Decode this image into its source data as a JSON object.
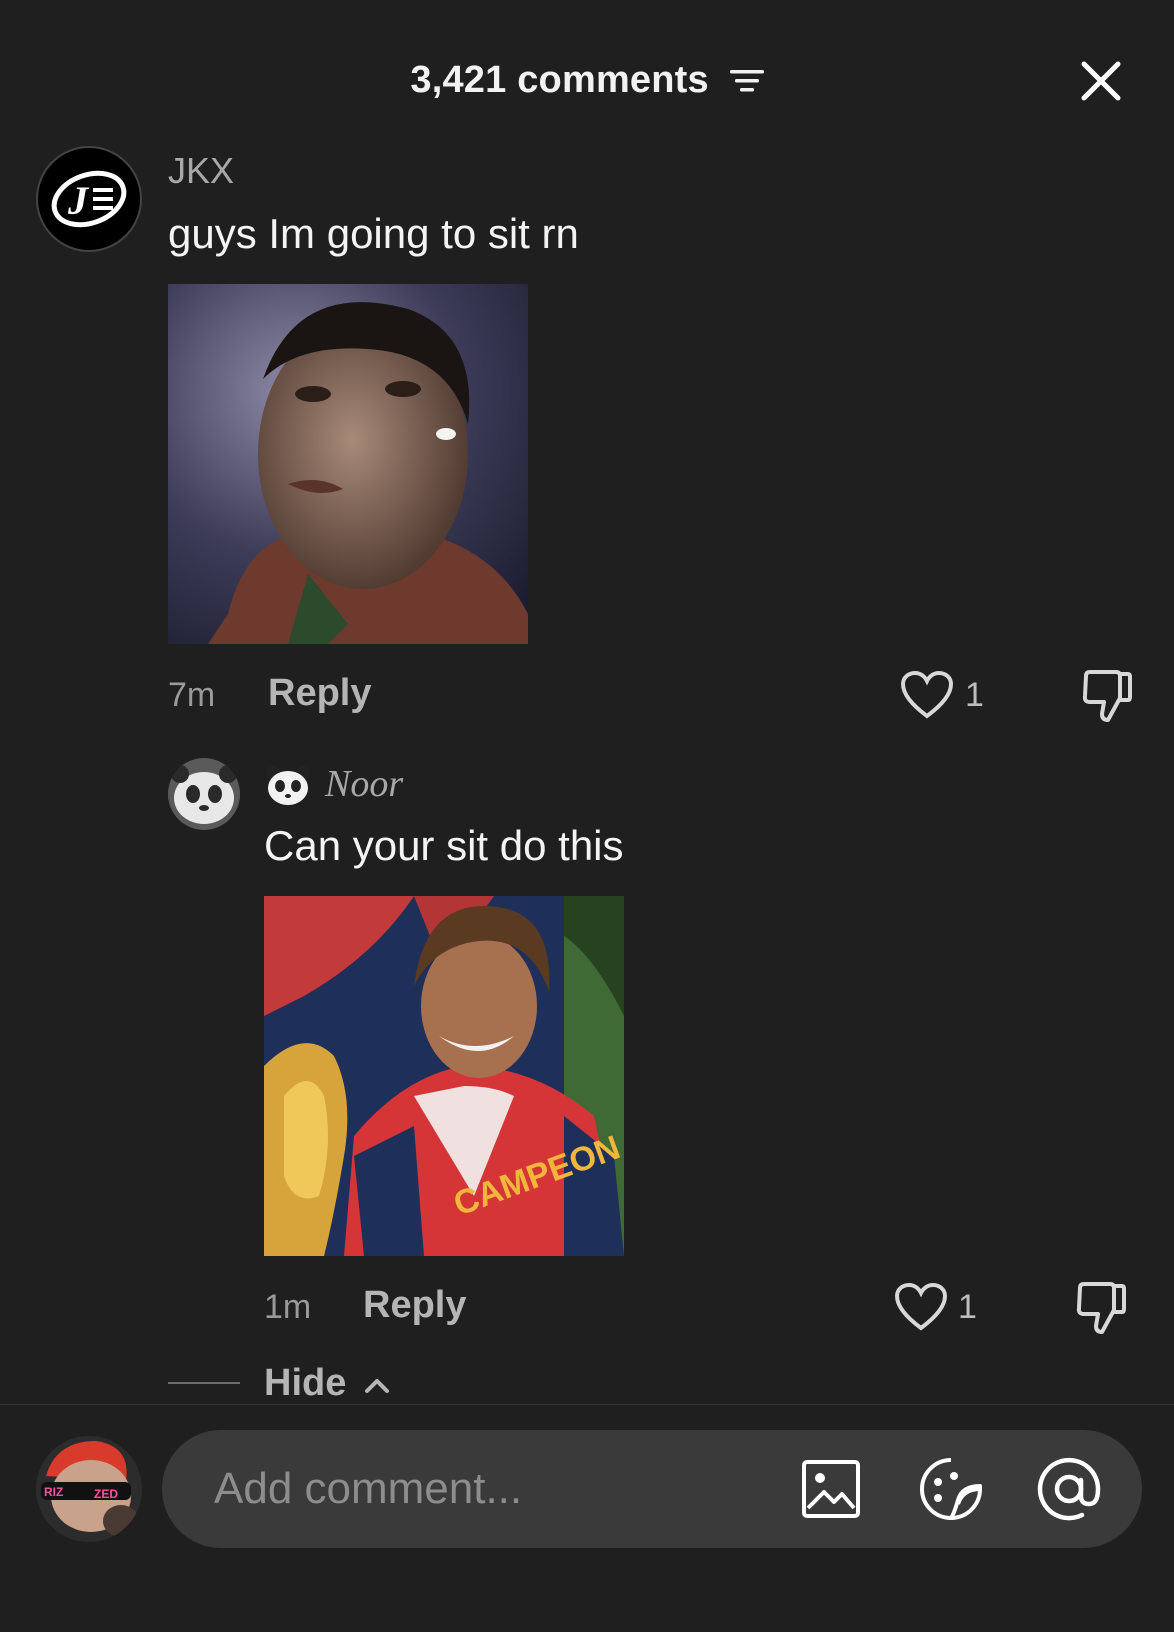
{
  "header": {
    "title": "3,421 comments",
    "sort_icon": "sort-lines-icon",
    "close_icon": "close-icon"
  },
  "comments": [
    {
      "user": "JKX",
      "text": "guys Im going to sit rn",
      "time": "7m",
      "reply_label": "Reply",
      "likes": "1",
      "image_desc": "meme-photo"
    }
  ],
  "replies": [
    {
      "user": "Noor",
      "text": "Can your sit do this",
      "time": "1m",
      "reply_label": "Reply",
      "likes": "1",
      "image_desc": "trophy-photo",
      "badge_icon": "panda-icon"
    }
  ],
  "hide_label": "Hide",
  "input": {
    "placeholder": "Add comment...",
    "icons": [
      "image-icon",
      "sticker-icon",
      "mention-icon"
    ]
  },
  "colors": {
    "background": "#1f1f1f",
    "input_bg": "#3a3a3a",
    "text_muted": "#9a9a9a"
  }
}
